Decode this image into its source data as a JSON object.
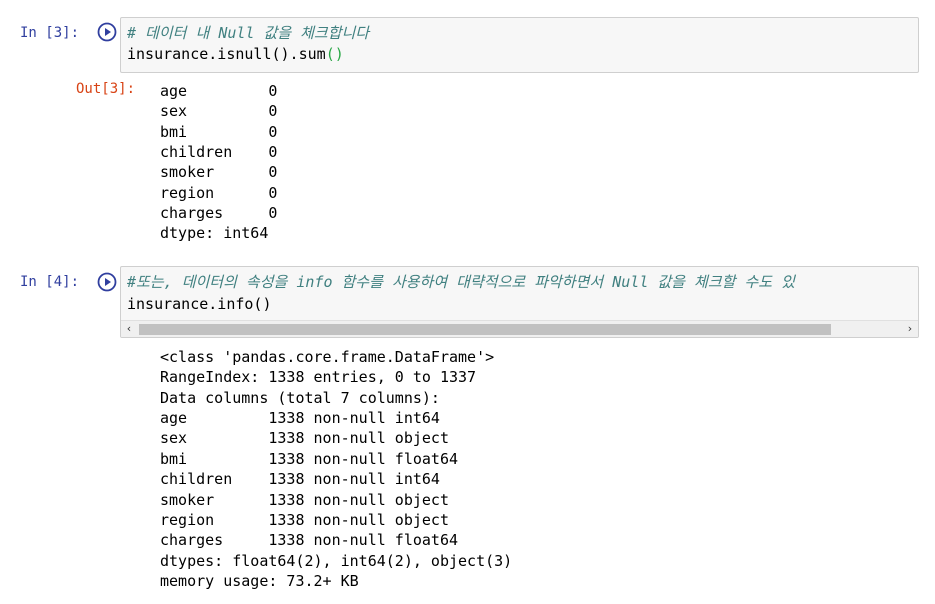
{
  "cell3": {
    "in_prompt": "In [3]:",
    "code_comment": "# 데이터 내 Null 값을 체크합니다",
    "code_main": "insurance.isnull().sum",
    "code_parens": "()",
    "out_prompt": "Out[3]:",
    "output_lines": [
      "age         0",
      "sex         0",
      "bmi         0",
      "children    0",
      "smoker      0",
      "region      0",
      "charges     0",
      "dtype: int64"
    ]
  },
  "cell4": {
    "in_prompt": "In [4]:",
    "code_comment": "#또는, 데이터의 속성을 info 함수를 사용하여 대략적으로 파악하면서 Null 값을 체크할 수도 있",
    "code_main": "insurance.info()",
    "scroll_left": "‹",
    "scroll_right": "›",
    "output_lines": [
      "<class 'pandas.core.frame.DataFrame'>",
      "RangeIndex: 1338 entries, 0 to 1337",
      "Data columns (total 7 columns):",
      "age         1338 non-null int64",
      "sex         1338 non-null object",
      "bmi         1338 non-null float64",
      "children    1338 non-null int64",
      "smoker      1338 non-null object",
      "region      1338 non-null object",
      "charges     1338 non-null float64",
      "dtypes: float64(2), int64(2), object(3)",
      "memory usage: 73.2+ KB"
    ]
  },
  "colors": {
    "prompt": "#303f9f",
    "out_prompt": "#d84315",
    "comment": "#408080",
    "run_icon": "#303f9f"
  },
  "icons": {
    "run": "run-circle-icon"
  }
}
